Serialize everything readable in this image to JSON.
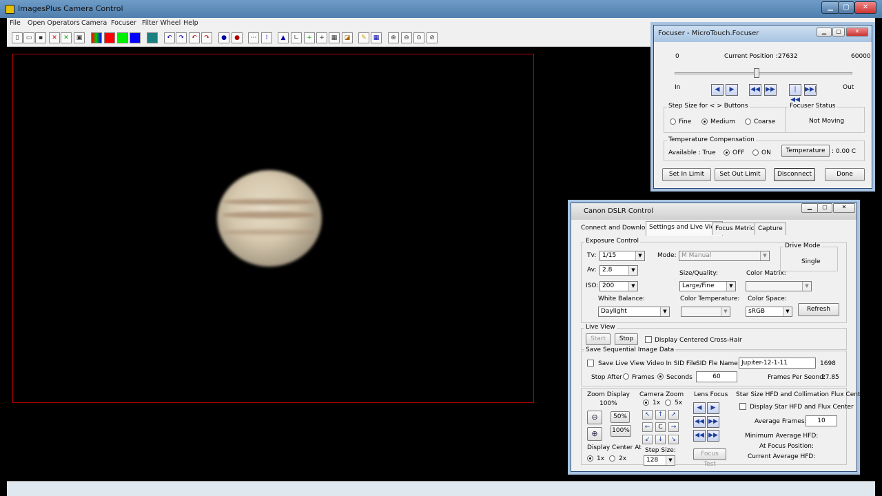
{
  "app": {
    "title": "ImagesPlus Camera Control"
  },
  "menu": [
    "File",
    "Open Operators",
    "Camera",
    "Focuser",
    "Filter Wheel",
    "Help"
  ],
  "focuser": {
    "title": "Focuser - MicroTouch.Focuser",
    "min": "0",
    "max": "60000",
    "current_label": "Current Position :",
    "current_value": "27632",
    "position_fraction": 0.4605,
    "in_label": "In",
    "out_label": "Out",
    "step_group": "Step Size for < > Buttons",
    "fine": "Fine",
    "medium": "Medium",
    "coarse": "Coarse",
    "status_group": "Focuser Status",
    "status": "Not Moving",
    "temp_group": "Temperature Compensation",
    "available": "Available : True",
    "off": "OFF",
    "on": "ON",
    "temp_button": "Temperature",
    "temp_value": ": 0.00 C",
    "set_in": "Set In Limit",
    "set_out": "Set Out Limit",
    "disconnect": "Disconnect",
    "done": "Done"
  },
  "dslr": {
    "title": "Canon DSLR Control",
    "tabs": [
      "Connect and Download",
      "Settings and Live View",
      "Focus Metrics",
      "Capture"
    ],
    "exposure_group": "Exposure Control",
    "tv_label": "Tv:",
    "tv": "1/15",
    "av_label": "Av:",
    "av": "2.8",
    "iso_label": "ISO:",
    "iso": "200",
    "mode_label": "Mode:",
    "mode": "M Manual",
    "drive_group": "Drive Mode",
    "drive": "Single",
    "size_label": "Size/Quality:",
    "size": "Large/Fine",
    "matrix_label": "Color Matrix:",
    "wb_label": "White Balance:",
    "wb": "Daylight",
    "ctemp_label": "Color Temperature:",
    "cspace_label": "Color Space:",
    "cspace": "sRGB",
    "refresh": "Refresh",
    "live_group": "Live View",
    "start": "Start",
    "stop": "Stop",
    "crosshair": "Display Centered Cross-Hair",
    "seq_group": "Save Sequential Image Data",
    "save_sid": "Save Live View Video In SID File",
    "sid_label": "SID Fle Name:",
    "sid_value": "Jupiter-12-1-11",
    "sid_count": "1698",
    "stop_after": "Stop After",
    "frames": "Frames",
    "seconds": "Seconds",
    "stop_value": "60",
    "fps_label": "Frames Per Seond:",
    "fps": "27.85",
    "zoom_label": "Zoom Display",
    "zoom_value": "100%",
    "z50": "50%",
    "z100": "100%",
    "center_label": "Display Center At",
    "c1x": "1x",
    "c2x": "2x",
    "camzoom_label": "Camera Zoom",
    "cz1": "1x",
    "cz5": "5x",
    "step_label": "Step Size:",
    "step": "128",
    "center_btn": "C",
    "lens_label": "Lens Focus",
    "focus_test": "Focus Test",
    "star_label": "Star Size HFD and Collimation Flux Center",
    "star_chk": "Display Star HFD and Flux Center",
    "avg_label": "Average Frames:",
    "avg": "10",
    "min_hfd": "Minimum Average HFD:",
    "at_focus": "At Focus Position:",
    "cur_hfd": "Current Average HFD:"
  }
}
